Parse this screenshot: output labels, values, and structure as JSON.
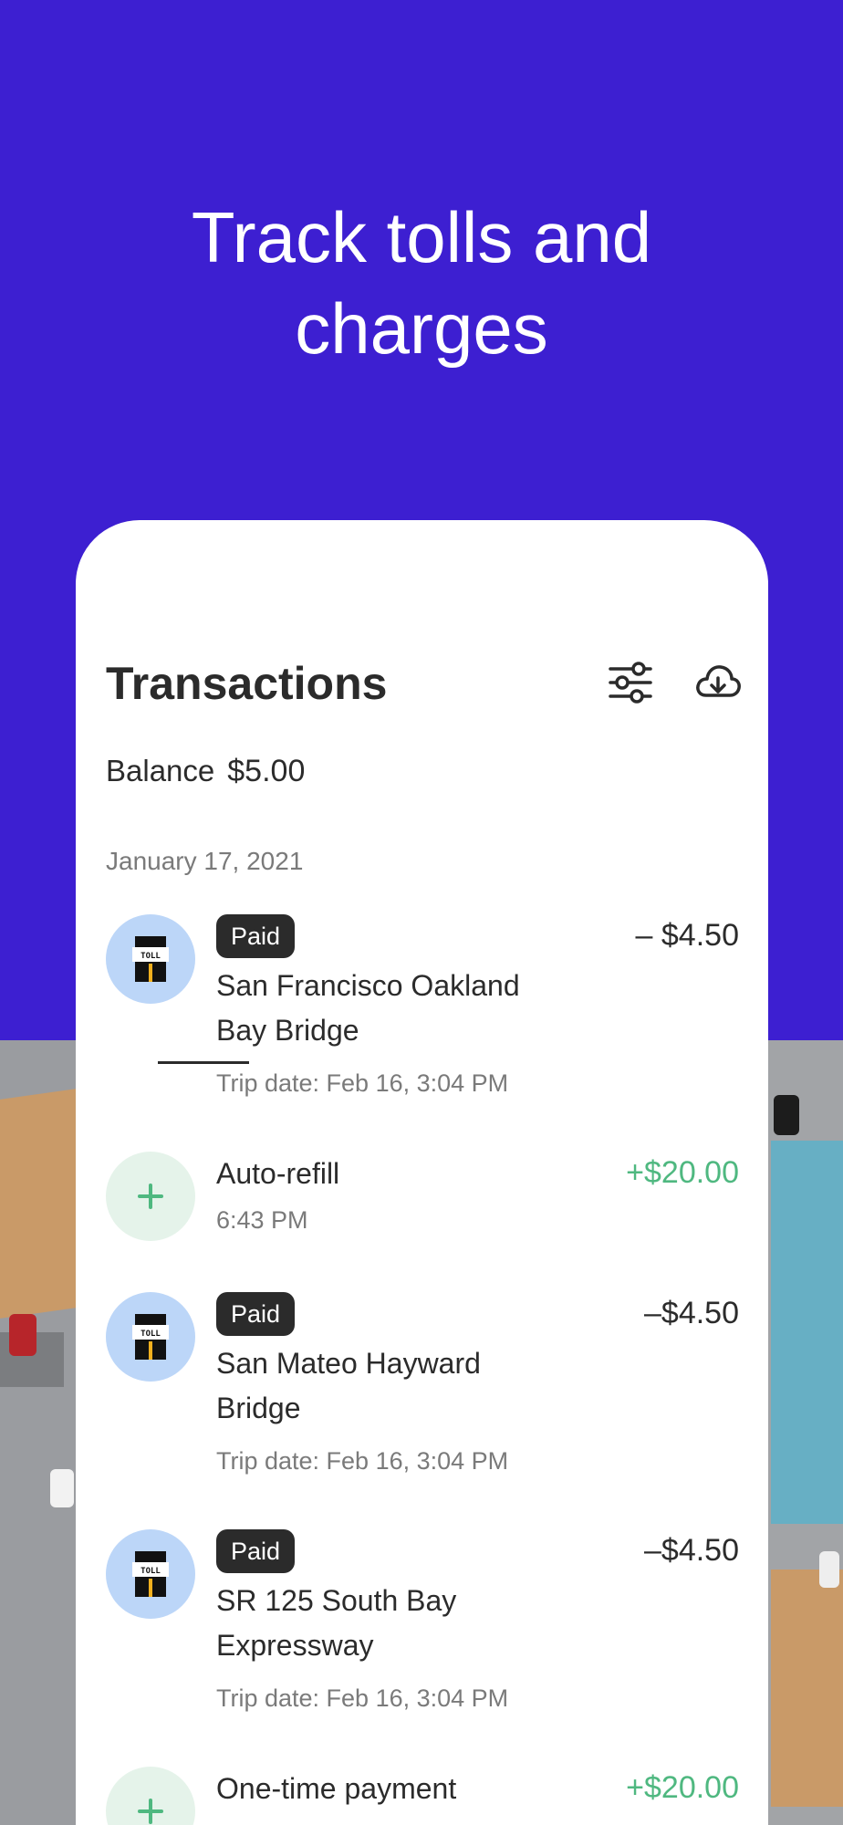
{
  "hero": {
    "title_line1": "Track tolls and",
    "title_line2": "charges"
  },
  "header": {
    "title": "Transactions",
    "filter_icon": "sliders-icon",
    "download_icon": "cloud-download-icon"
  },
  "balance": {
    "label": "Balance",
    "amount": "$5.00"
  },
  "date_group": "January 17, 2021",
  "transactions": [
    {
      "type": "toll",
      "icon": "toll-icon",
      "badge": "Paid",
      "name_line1": "San Francisco Oakland",
      "name_line2": "Bay Bridge",
      "sub": "Trip date: Feb 16, 3:04 PM",
      "amount": "– $4.50"
    },
    {
      "type": "refill",
      "icon": "plus-icon",
      "name_line1": "Auto-refill",
      "sub": "6:43 PM",
      "amount": "+$20.00"
    },
    {
      "type": "toll",
      "icon": "toll-icon",
      "badge": "Paid",
      "name_line1": "San Mateo Hayward",
      "name_line2": "Bridge",
      "sub": "Trip date: Feb 16, 3:04 PM",
      "amount": "–$4.50"
    },
    {
      "type": "toll",
      "icon": "toll-icon",
      "badge": "Paid",
      "name_line1": "SR 125 South Bay",
      "name_line2": "Expressway",
      "sub": "Trip date: Feb 16, 3:04 PM",
      "amount": "–$4.50"
    },
    {
      "type": "refill",
      "icon": "plus-icon",
      "name_line1": "One-time payment",
      "amount": "+$20.00"
    }
  ],
  "toll_sign_text": "TOLL",
  "colors": {
    "brand": "#3d1fd1",
    "positive": "#4fb880",
    "text": "#2b2b2b",
    "muted": "#7a7a7a",
    "toll_bg": "#bcd6f8",
    "refill_bg": "#e5f3ea"
  }
}
